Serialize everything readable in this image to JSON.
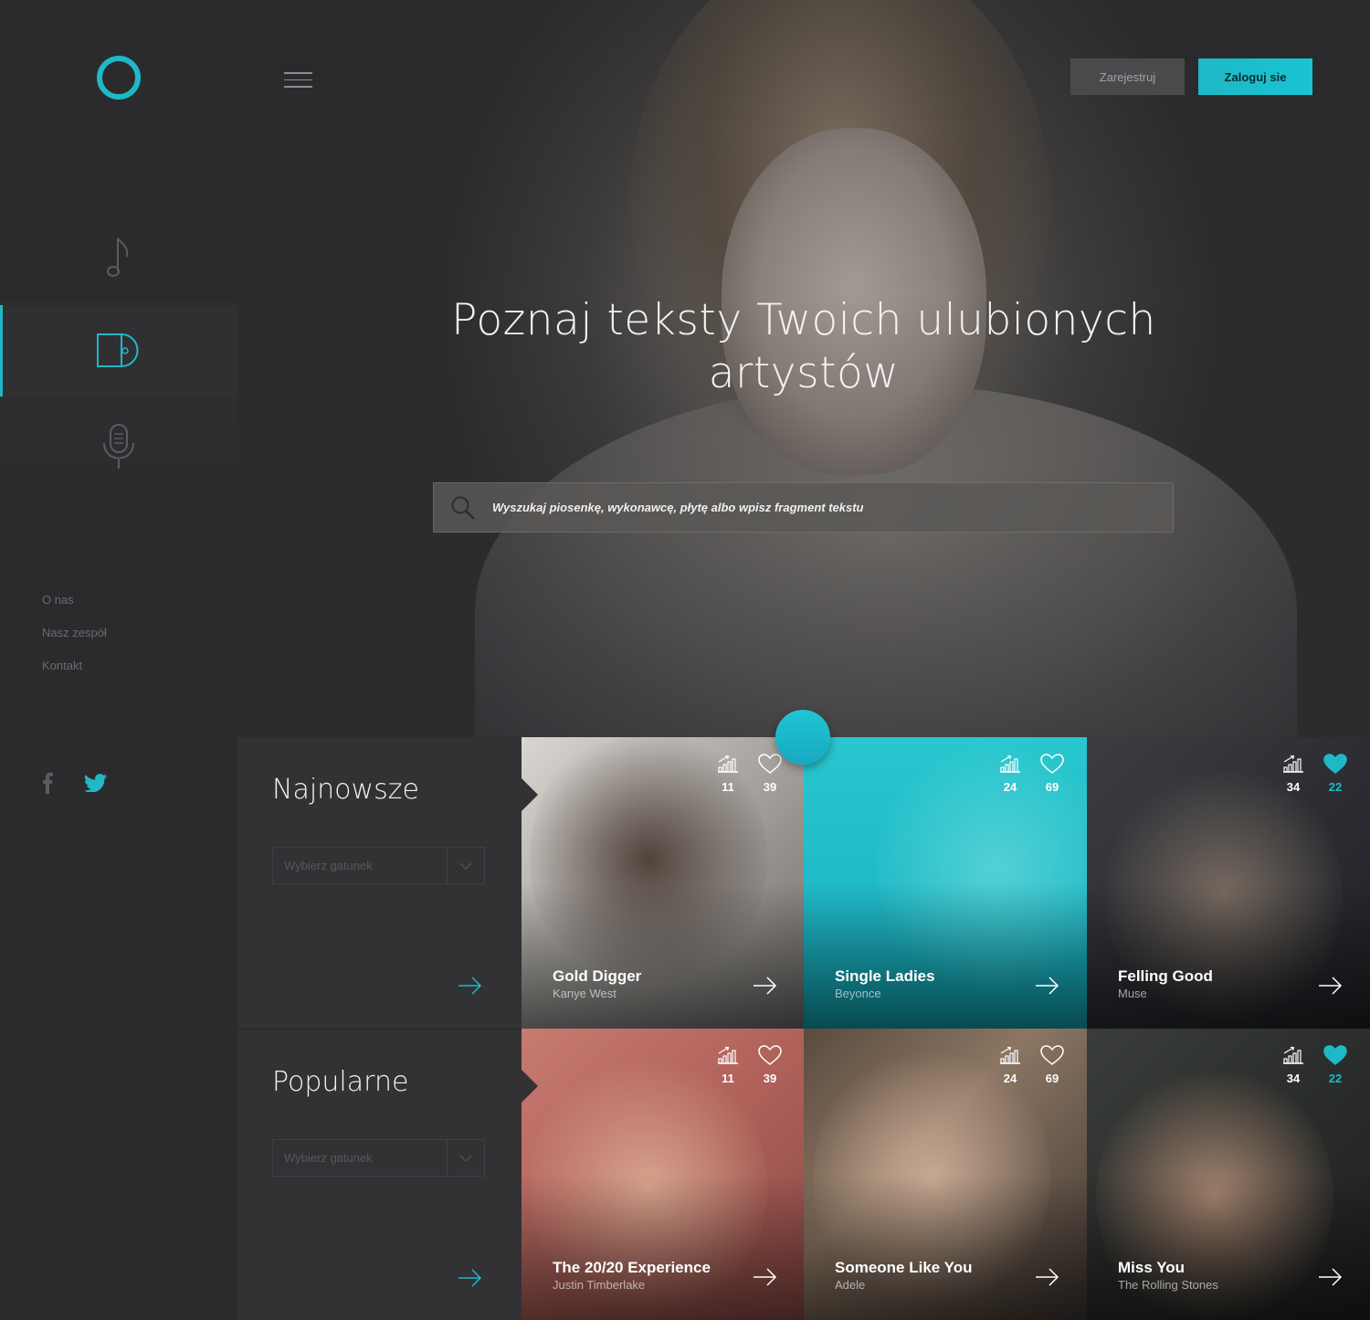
{
  "sidebar": {
    "links": [
      "O nas",
      "Nasz zespół",
      "Kontakt"
    ],
    "icons": {
      "music": "music-note-icon",
      "album": "album-icon",
      "mic": "microphone-icon",
      "facebook": "facebook-icon",
      "twitter": "twitter-icon"
    }
  },
  "header": {
    "register_label": "Zarejestruj",
    "login_label": "Zaloguj sie"
  },
  "hero": {
    "title": "Poznaj teksty Twoich ulubionych artystów",
    "search_placeholder": "Wyszukaj piosenkę, wykonawcę, płytę albo wpisz fragment tekstu"
  },
  "sections": [
    {
      "title": "Najnowsze",
      "genre_placeholder": "Wybierz gatunek"
    },
    {
      "title": "Popularne",
      "genre_placeholder": "Wybierz gatunek"
    }
  ],
  "cards": [
    {
      "song": "Gold Digger",
      "artist": "Kanye West",
      "views": "11",
      "likes": "39",
      "liked": false
    },
    {
      "song": "Single Ladies",
      "artist": "Beyonce",
      "views": "24",
      "likes": "69",
      "liked": false
    },
    {
      "song": "Felling Good",
      "artist": "Muse",
      "views": "34",
      "likes": "22",
      "liked": true
    },
    {
      "song": "The 20/20 Experience",
      "artist": "Justin Timberlake",
      "views": "11",
      "likes": "39",
      "liked": false
    },
    {
      "song": "Someone Like You",
      "artist": "Adele",
      "views": "24",
      "likes": "69",
      "liked": false
    },
    {
      "song": "Miss You",
      "artist": "The Rolling Stones",
      "views": "34",
      "likes": "22",
      "liked": true
    }
  ],
  "colors": {
    "accent": "#1fb8c6",
    "sidebar": "#2b2b2d",
    "panel": "#323235"
  }
}
